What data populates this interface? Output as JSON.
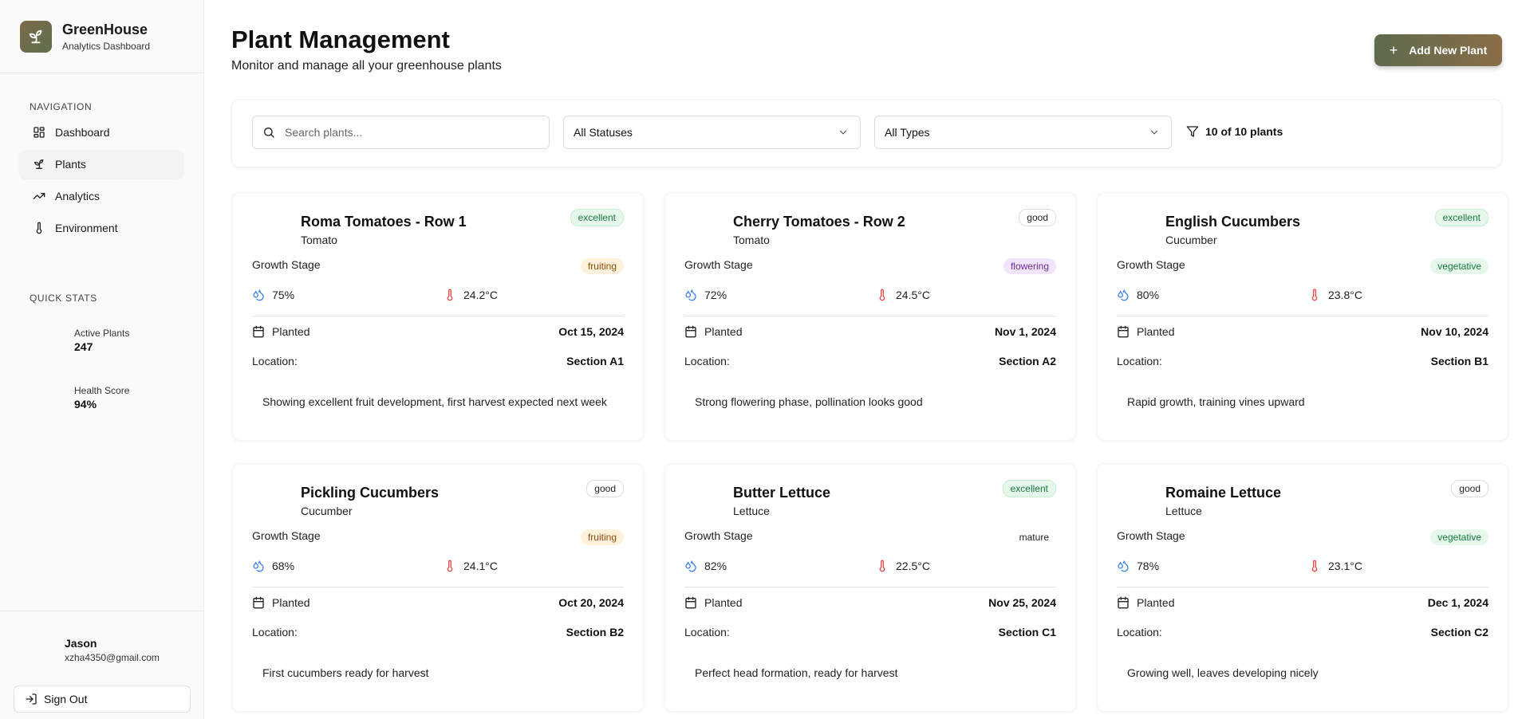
{
  "brand": {
    "name": "GreenHouse",
    "subtitle": "Analytics Dashboard",
    "logo_icon": "sprout-icon"
  },
  "sidebar": {
    "nav_label": "NAVIGATION",
    "items": [
      {
        "label": "Dashboard",
        "icon": "grid-icon",
        "active": false
      },
      {
        "label": "Plants",
        "icon": "sprout-icon",
        "active": true
      },
      {
        "label": "Analytics",
        "icon": "trending-up-icon",
        "active": false
      },
      {
        "label": "Environment",
        "icon": "thermometer-icon",
        "active": false
      }
    ],
    "stats_label": "QUICK STATS",
    "stats": [
      {
        "label": "Active Plants",
        "value": "247"
      },
      {
        "label": "Health Score",
        "value": "94%"
      }
    ],
    "user": {
      "name": "Jason",
      "email": "xzha4350@gmail.com"
    },
    "sign_out": "Sign Out"
  },
  "header": {
    "title": "Plant Management",
    "subtitle": "Monitor and manage all your greenhouse plants",
    "add_button": "Add New Plant"
  },
  "filters": {
    "search_placeholder": "Search plants...",
    "status": "All Statuses",
    "type": "All Types",
    "count": "10 of 10 plants"
  },
  "labels": {
    "growth_stage": "Growth Stage",
    "planted": "Planted",
    "location": "Location:"
  },
  "colors": {
    "accent": "#6b6b4d",
    "humidity": "#3b82f6",
    "temperature": "#ef4444"
  },
  "plants": [
    {
      "name": "Roma Tomatoes - Row 1",
      "type": "Tomato",
      "health": "excellent",
      "stage": "fruiting",
      "humidity": "75%",
      "temperature": "24.2°C",
      "planted": "Oct 15, 2024",
      "location": "Section A1",
      "note": "Showing excellent fruit development, first harvest expected next week"
    },
    {
      "name": "Cherry Tomatoes - Row 2",
      "type": "Tomato",
      "health": "good",
      "stage": "flowering",
      "humidity": "72%",
      "temperature": "24.5°C",
      "planted": "Nov 1, 2024",
      "location": "Section A2",
      "note": "Strong flowering phase, pollination looks good"
    },
    {
      "name": "English Cucumbers",
      "type": "Cucumber",
      "health": "excellent",
      "stage": "vegetative",
      "humidity": "80%",
      "temperature": "23.8°C",
      "planted": "Nov 10, 2024",
      "location": "Section B1",
      "note": "Rapid growth, training vines upward"
    },
    {
      "name": "Pickling Cucumbers",
      "type": "Cucumber",
      "health": "good",
      "stage": "fruiting",
      "humidity": "68%",
      "temperature": "24.1°C",
      "planted": "Oct 20, 2024",
      "location": "Section B2",
      "note": "First cucumbers ready for harvest"
    },
    {
      "name": "Butter Lettuce",
      "type": "Lettuce",
      "health": "excellent",
      "stage": "mature",
      "humidity": "82%",
      "temperature": "22.5°C",
      "planted": "Nov 25, 2024",
      "location": "Section C1",
      "note": "Perfect head formation, ready for harvest"
    },
    {
      "name": "Romaine Lettuce",
      "type": "Lettuce",
      "health": "good",
      "stage": "vegetative",
      "humidity": "78%",
      "temperature": "23.1°C",
      "planted": "Dec 1, 2024",
      "location": "Section C2",
      "note": "Growing well, leaves developing nicely"
    }
  ]
}
